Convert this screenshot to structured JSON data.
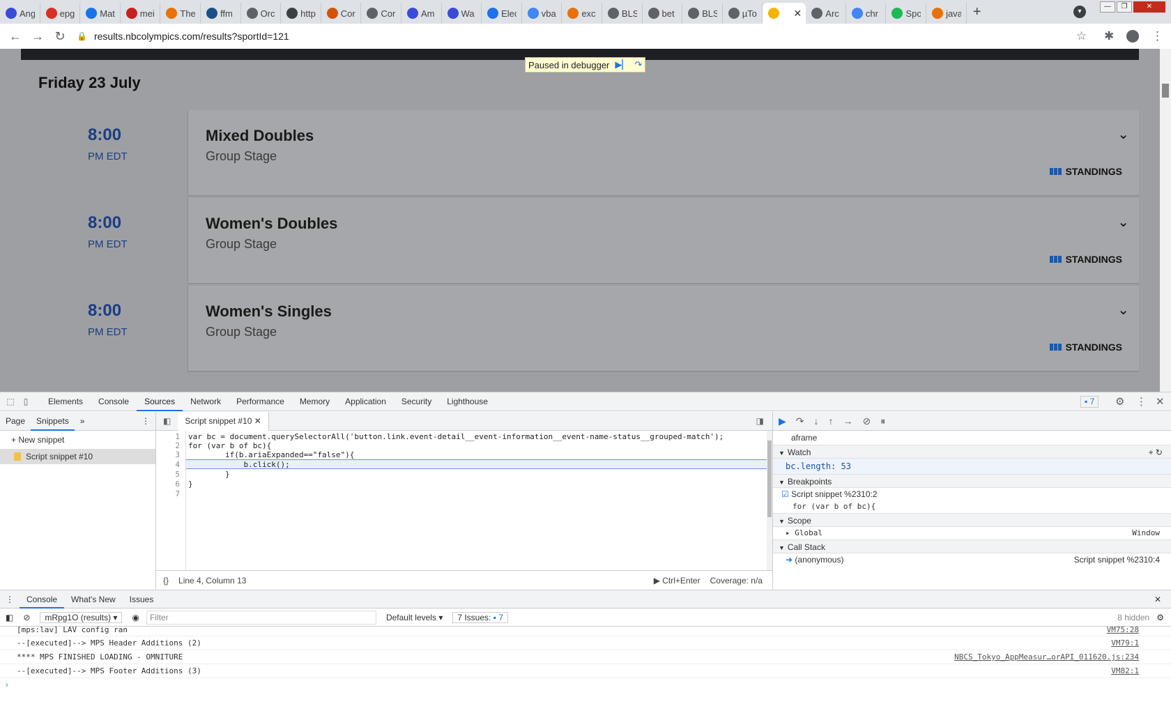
{
  "browser": {
    "tabs": [
      {
        "title": "Ang",
        "color": "#3b4bd8"
      },
      {
        "title": "epg",
        "color": "#d93025"
      },
      {
        "title": "Mat",
        "color": "#1a73e8"
      },
      {
        "title": "mei",
        "color": "#c5221f"
      },
      {
        "title": "The",
        "color": "#e8710a"
      },
      {
        "title": "ffm",
        "color": "#1a4f8a"
      },
      {
        "title": "Orc",
        "color": "#5f6368"
      },
      {
        "title": "http",
        "color": "#3c4043"
      },
      {
        "title": "Cor",
        "color": "#d35400"
      },
      {
        "title": "Cor",
        "color": "#5f6368"
      },
      {
        "title": "Am",
        "color": "#3b4bd8"
      },
      {
        "title": "Wa",
        "color": "#3b4bd8"
      },
      {
        "title": "Elec",
        "color": "#1a73e8"
      },
      {
        "title": "vba",
        "color": "#4285f4"
      },
      {
        "title": "exc",
        "color": "#e8710a"
      },
      {
        "title": "BLS",
        "color": "#5f6368"
      },
      {
        "title": "bet",
        "color": "#5f6368"
      },
      {
        "title": "BLS",
        "color": "#5f6368"
      },
      {
        "title": "µTo",
        "color": "#5f6368"
      },
      {
        "title": "",
        "color": "#f4b400"
      },
      {
        "title": "Arc",
        "color": "#5f6368"
      },
      {
        "title": "chr",
        "color": "#4285f4"
      },
      {
        "title": "Spo",
        "color": "#1db954"
      },
      {
        "title": "java",
        "color": "#e8710a"
      }
    ],
    "url": "results.nbcolympics.com/results?sportId=121"
  },
  "page": {
    "paused_label": "Paused in debugger",
    "day_title": "Friday 23 July",
    "events": [
      {
        "time": "8:00",
        "zone": "PM EDT",
        "name": "Mixed Doubles",
        "stage": "Group Stage",
        "standings": "STANDINGS"
      },
      {
        "time": "8:00",
        "zone": "PM EDT",
        "name": "Women's Doubles",
        "stage": "Group Stage",
        "standings": "STANDINGS"
      },
      {
        "time": "8:00",
        "zone": "PM EDT",
        "name": "Women's Singles",
        "stage": "Group Stage",
        "standings": "STANDINGS"
      }
    ]
  },
  "devtools": {
    "tabs": [
      "Elements",
      "Console",
      "Sources",
      "Network",
      "Performance",
      "Memory",
      "Application",
      "Security",
      "Lighthouse"
    ],
    "active_tab": "Sources",
    "issues_count": "7",
    "navigator": {
      "tabs": [
        "Page",
        "Snippets"
      ],
      "new_snippet": "New snippet",
      "selected": "Script snippet #10"
    },
    "editor": {
      "file_tab": "Script snippet #10",
      "lines": [
        "var bc = document.querySelectorAll('button.link.event-detail__event-information__event-name-status__grouped-match');",
        "for (var b of bc){",
        "        if(b.ariaExpanded==\"false\"){",
        "            b.click();",
        "        }",
        "}",
        ""
      ],
      "status_position": "Line 4, Column 13",
      "run_hint": "Ctrl+Enter",
      "coverage": "Coverage: n/a"
    },
    "debugger": {
      "frame": "aframe",
      "watch_label": "Watch",
      "watch_expr": "bc.length: 53",
      "breakpoints_label": "Breakpoints",
      "breakpoint_name": "Script snippet %2310:2",
      "breakpoint_code": "for (var b of bc){",
      "scope_label": "Scope",
      "global_label": "Global",
      "global_value": "Window",
      "callstack_label": "Call Stack",
      "frame_name": "(anonymous)",
      "frame_location": "Script snippet %2310:4"
    },
    "console": {
      "drawer_tabs": [
        "Console",
        "What's New",
        "Issues"
      ],
      "context": "mRpg1O (results)",
      "filter_placeholder": "Filter",
      "levels": "Default levels",
      "issues": "7 Issues:",
      "issues_n": "7",
      "hidden": "8 hidden",
      "messages": [
        {
          "text": "[mps:lav] LAV config ran",
          "source": "VM75:28"
        },
        {
          "text": "--[executed]--> MPS Header Additions (2)",
          "source": "VM79:1"
        },
        {
          "text": "**** MPS FINISHED LOADING - OMNITURE",
          "source": "NBCS_Tokyo_AppMeasur…orAPI_011620.js:234"
        },
        {
          "text": "--[executed]--> MPS Footer Additions (3)",
          "source": "VM82:1"
        }
      ]
    }
  }
}
